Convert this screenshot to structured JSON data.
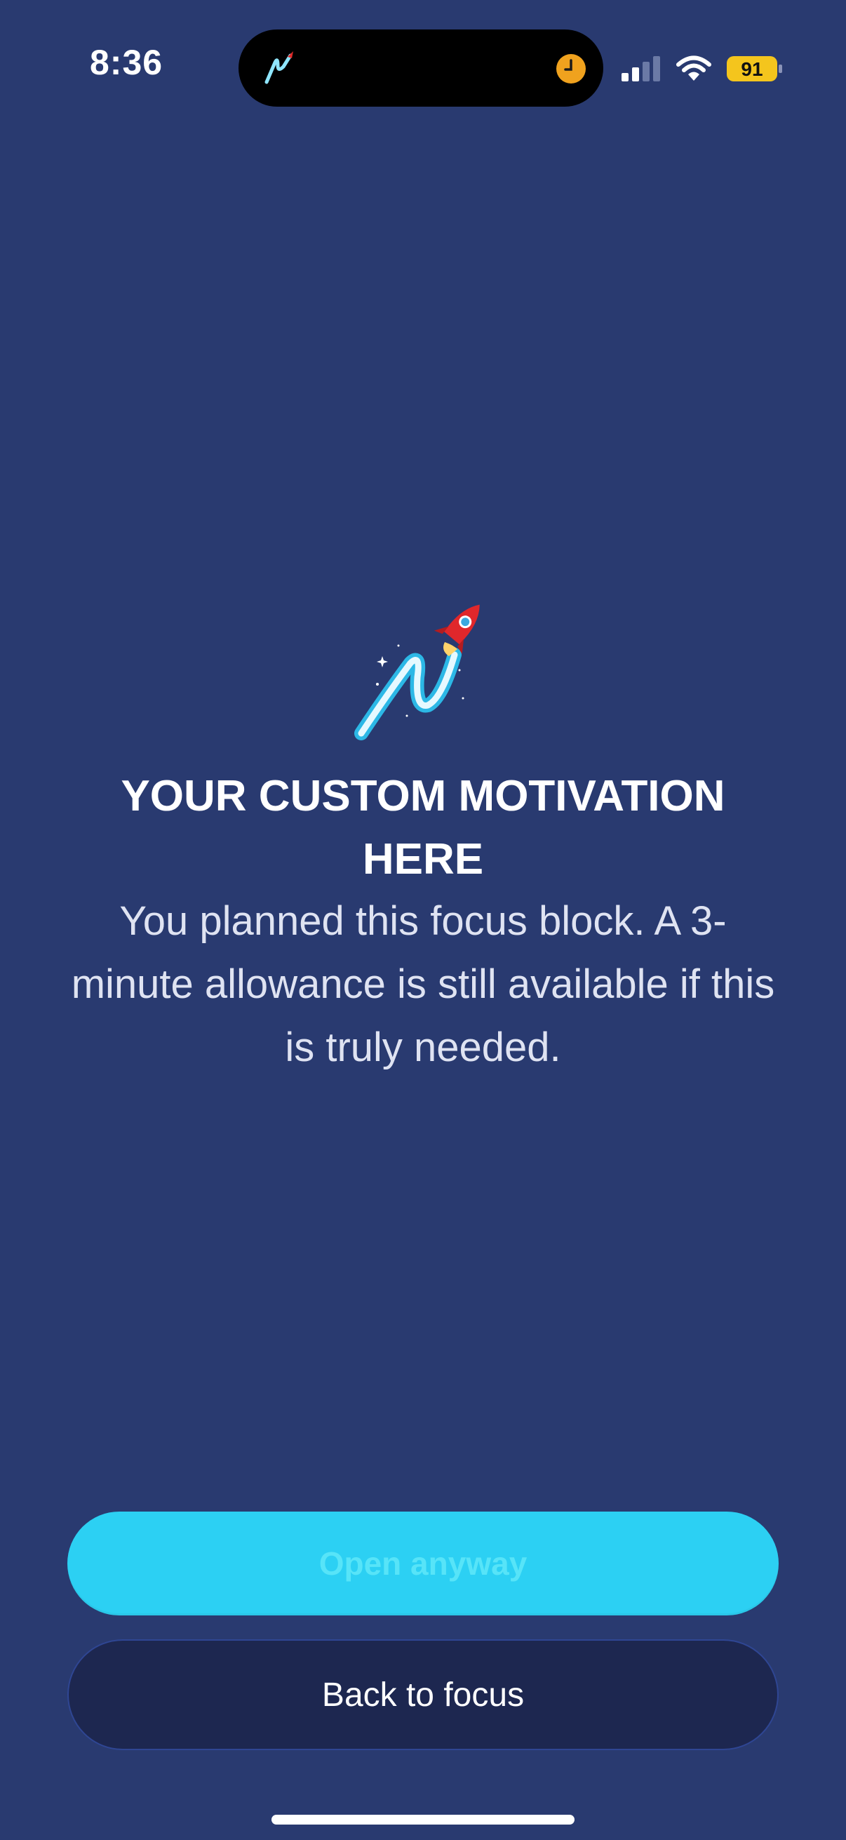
{
  "status_bar": {
    "time": "8:36",
    "battery_level": "91",
    "battery_color": "#f4c51d",
    "signal_bars_active": 2,
    "signal_bars_total": 4,
    "icons": [
      "app-logo-icon",
      "timer-icon",
      "signal-icon",
      "wifi-icon",
      "battery-icon"
    ]
  },
  "main": {
    "logo_icon": "rocket-logo-icon",
    "title": "YOUR CUSTOM MOTIVATION HERE",
    "message": "You planned this focus block. A 3-minute allowance is still available if this is truly needed."
  },
  "actions": {
    "open_anyway_label": "Open anyway",
    "back_to_focus_label": "Back to focus"
  },
  "colors": {
    "background": "#293a70",
    "primary_button": "#2cd0f3",
    "secondary_button": "#1d2750"
  }
}
